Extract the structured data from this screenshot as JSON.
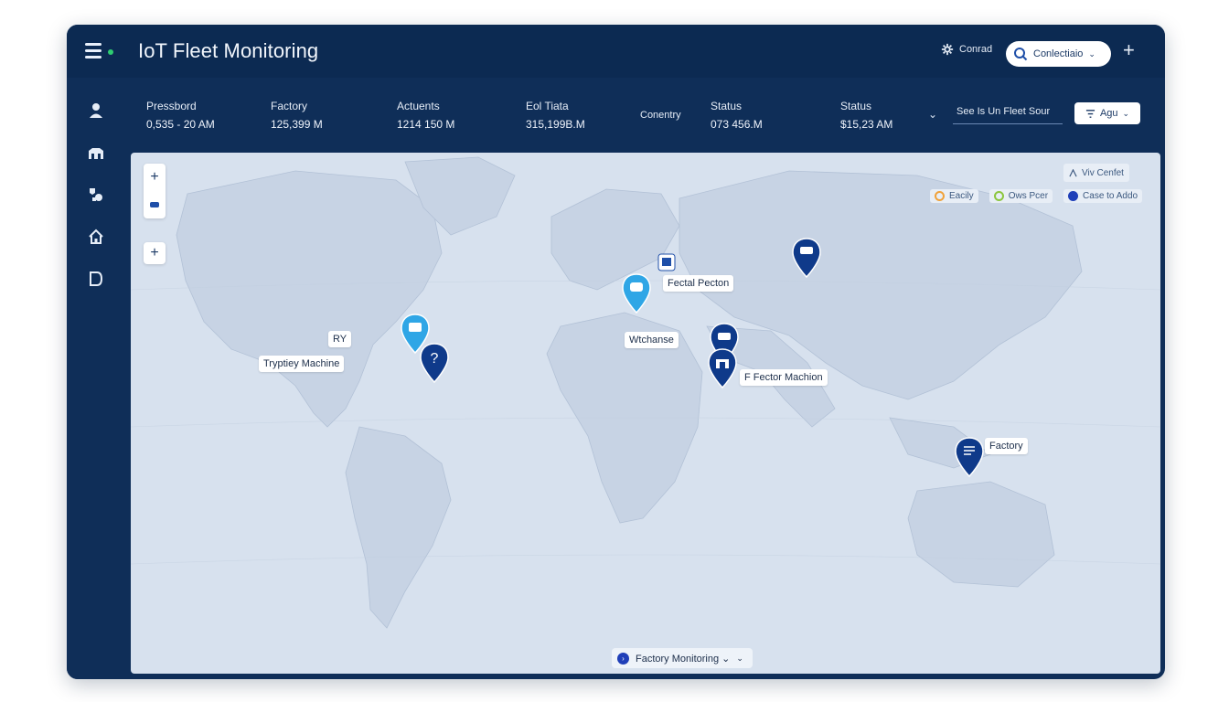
{
  "header": {
    "title": "IoT Fleet Monitoring",
    "settings_label": "Conrad",
    "pill_label": "Conlectiaio",
    "add_label": "+"
  },
  "sidebar": {
    "items": [
      {
        "icon": "user-icon"
      },
      {
        "icon": "factory-icon"
      },
      {
        "icon": "devices-icon"
      },
      {
        "icon": "home-icon"
      },
      {
        "icon": "document-icon"
      }
    ]
  },
  "stats": [
    {
      "label": "Pressbord",
      "value": "0,535 - 20 AM"
    },
    {
      "label": "Factory",
      "value": "125,399 M"
    },
    {
      "label": "Actuents",
      "value": "1214 150 M"
    },
    {
      "label": "Eol Tiata",
      "value": "315,199B.M"
    },
    {
      "label": "Conentry",
      "value": ""
    },
    {
      "label": "Status",
      "value": "073 456.M"
    },
    {
      "label": "Status",
      "value": "$15,23 AM"
    }
  ],
  "stats_controls": {
    "chevron": "⌄",
    "search_placeholder": "See Is Un Fleet Sour",
    "filter_label": "Agu"
  },
  "map": {
    "zoom_in": "+",
    "zoom_plus2": "+",
    "view_toggle": "Viv Cenfet",
    "legend": [
      {
        "label": "Eacily",
        "color": "#f0a23a"
      },
      {
        "label": "Ows Pcer",
        "color": "#8cc63f"
      },
      {
        "label": "Case to Addo",
        "color": "#1f3fb8"
      }
    ],
    "labels": {
      "tryptiey_machine": "Tryptiey Machine",
      "small_tag": "RY",
      "fectal_pecton": "Fectal Pecton",
      "wtchanse": "Wtchanse",
      "factor_machion": "F Fector Machion",
      "factory": "Factory"
    },
    "bottom_dropdown": "Factory Monitoring ⌄"
  }
}
